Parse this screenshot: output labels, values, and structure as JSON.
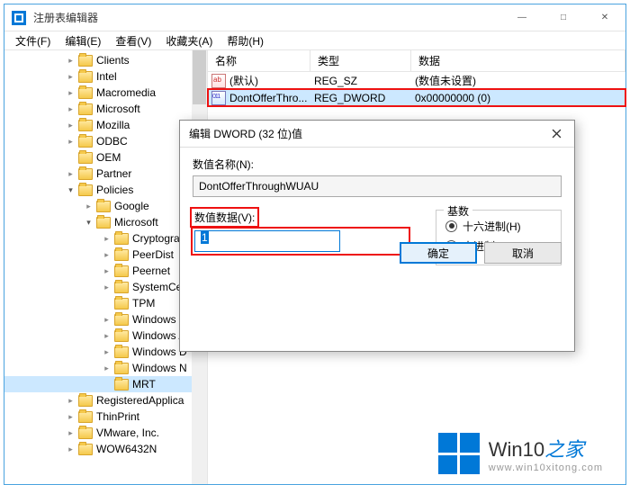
{
  "window": {
    "title": "注册表编辑器",
    "controls": {
      "min": "—",
      "max": "□",
      "close": "✕"
    }
  },
  "menu": {
    "file": "文件(F)",
    "edit": "编辑(E)",
    "view": "查看(V)",
    "favorites": "收藏夹(A)",
    "help": "帮助(H)"
  },
  "tree": [
    {
      "indent": 68,
      "exp": "›",
      "label": "Clients"
    },
    {
      "indent": 68,
      "exp": "›",
      "label": "Intel"
    },
    {
      "indent": 68,
      "exp": "›",
      "label": "Macromedia"
    },
    {
      "indent": 68,
      "exp": "›",
      "label": "Microsoft"
    },
    {
      "indent": 68,
      "exp": "›",
      "label": "Mozilla"
    },
    {
      "indent": 68,
      "exp": "›",
      "label": "ODBC"
    },
    {
      "indent": 68,
      "exp": " ",
      "label": "OEM"
    },
    {
      "indent": 68,
      "exp": "›",
      "label": "Partner"
    },
    {
      "indent": 68,
      "exp": "⌄",
      "label": "Policies"
    },
    {
      "indent": 88,
      "exp": "›",
      "label": "Google"
    },
    {
      "indent": 88,
      "exp": "⌄",
      "label": "Microsoft"
    },
    {
      "indent": 108,
      "exp": "›",
      "label": "Cryptograp"
    },
    {
      "indent": 108,
      "exp": "›",
      "label": "PeerDist"
    },
    {
      "indent": 108,
      "exp": "›",
      "label": "Peernet"
    },
    {
      "indent": 108,
      "exp": "›",
      "label": "SystemCert"
    },
    {
      "indent": 108,
      "exp": " ",
      "label": "TPM"
    },
    {
      "indent": 108,
      "exp": "›",
      "label": "Windows"
    },
    {
      "indent": 108,
      "exp": "›",
      "label": "Windows A"
    },
    {
      "indent": 108,
      "exp": "›",
      "label": "Windows D"
    },
    {
      "indent": 108,
      "exp": "›",
      "label": "Windows N"
    },
    {
      "indent": 108,
      "exp": " ",
      "label": "MRT",
      "selected": true
    },
    {
      "indent": 68,
      "exp": "›",
      "label": "RegisteredApplica"
    },
    {
      "indent": 68,
      "exp": "›",
      "label": "ThinPrint"
    },
    {
      "indent": 68,
      "exp": "›",
      "label": "VMware, Inc."
    },
    {
      "indent": 68,
      "exp": "›",
      "label": "WOW6432N"
    }
  ],
  "list": {
    "headers": {
      "name": "名称",
      "type": "类型",
      "data": "数据"
    },
    "rows": [
      {
        "icon": "str",
        "name": "(默认)",
        "type": "REG_SZ",
        "data": "(数值未设置)"
      },
      {
        "icon": "dw",
        "name": "DontOfferThro...",
        "type": "REG_DWORD",
        "data": "0x00000000 (0)",
        "highlighted": true
      }
    ]
  },
  "dialog": {
    "title": "编辑 DWORD (32 位)值",
    "name_label": "数值名称(N):",
    "name_value": "DontOfferThroughWUAU",
    "value_label": "数值数据(V):",
    "value_input": "1",
    "base_label": "基数",
    "radio_hex": "十六进制(H)",
    "radio_dec": "十进制(D)",
    "ok": "确定",
    "cancel": "取消"
  },
  "watermark": {
    "brand1": "Win10",
    "brand2": "之家",
    "url": "www.win10xitong.com"
  }
}
